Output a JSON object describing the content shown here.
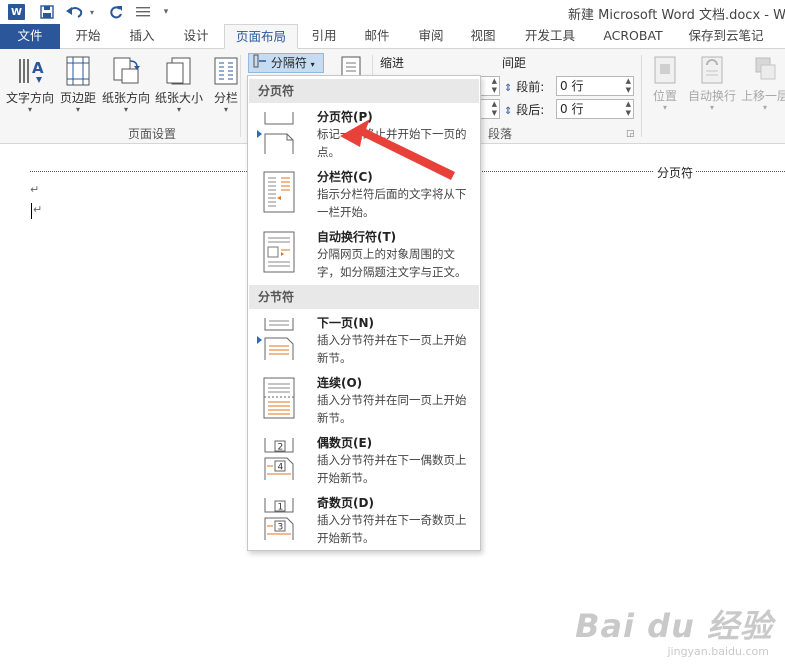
{
  "app": {
    "logo": "W",
    "title": "新建 Microsoft Word 文档.docx - Word"
  },
  "quick_access": {
    "save_icon": "save-icon",
    "undo_icon": "undo-icon",
    "redo_icon": "redo-icon",
    "customize_icon": "customize-icon"
  },
  "tabs": [
    "文件",
    "开始",
    "插入",
    "设计",
    "页面布局",
    "引用",
    "邮件",
    "审阅",
    "视图",
    "开发工具",
    "ACROBAT",
    "保存到云笔记"
  ],
  "active_tab": "页面布局",
  "ribbon": {
    "page_setup": {
      "buttons": [
        "文字方向",
        "页边距",
        "纸张方向",
        "纸张大小",
        "分栏"
      ],
      "breaks_label": "分隔符",
      "group_label": "页面设置"
    },
    "paragraph": {
      "indent_label": "缩进",
      "spacing_label": "间距",
      "before_label": "段前:",
      "before_value": "0 行",
      "after_label": "段后:",
      "after_value": "0 行",
      "group_label": "段落"
    },
    "arrange": {
      "buttons": [
        "位置",
        "自动换行",
        "上移一层"
      ]
    }
  },
  "document": {
    "page_break_label": "分页符",
    "paragraph_mark": "↵"
  },
  "breaks_menu": {
    "page_breaks_header": "分页符",
    "section_breaks_header": "分节符",
    "items": [
      {
        "title": "分页符(P)",
        "desc": "标记一页终止并开始下一页的点。"
      },
      {
        "title": "分栏符(C)",
        "desc": "指示分栏符后面的文字将从下一栏开始。"
      },
      {
        "title": "自动换行符(T)",
        "desc": "分隔网页上的对象周围的文字，如分隔题注文字与正文。"
      },
      {
        "title": "下一页(N)",
        "desc": "插入分节符并在下一页上开始新节。"
      },
      {
        "title": "连续(O)",
        "desc": "插入分节符并在同一页上开始新节。"
      },
      {
        "title": "偶数页(E)",
        "desc": "插入分节符并在下一偶数页上开始新节。"
      },
      {
        "title": "奇数页(D)",
        "desc": "插入分节符并在下一奇数页上开始新节。"
      }
    ]
  },
  "watermark": {
    "main": "Bai du 经验",
    "sub": "jingyan.baidu.com"
  },
  "colors": {
    "brand": "#2b579a",
    "accent_arrow": "#e8413a",
    "highlight": "#c5dcf2"
  }
}
